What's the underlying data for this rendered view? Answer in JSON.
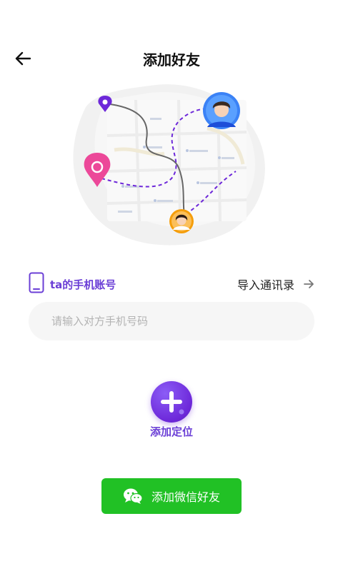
{
  "header": {
    "title": "添加好友",
    "back_icon": "arrow-left-icon"
  },
  "illustration": {
    "description_icon": "map-route-illustration"
  },
  "phone_section": {
    "label": "ta的手机账号",
    "import_label": "导入通讯录",
    "input_placeholder": "请输入对方手机号码",
    "input_value": ""
  },
  "add_location": {
    "label": "添加定位"
  },
  "wechat": {
    "label": "添加微信好友"
  },
  "colors": {
    "accent": "#6d28d9",
    "wechat_green": "#21c125",
    "pin_pink": "#ec4899"
  }
}
